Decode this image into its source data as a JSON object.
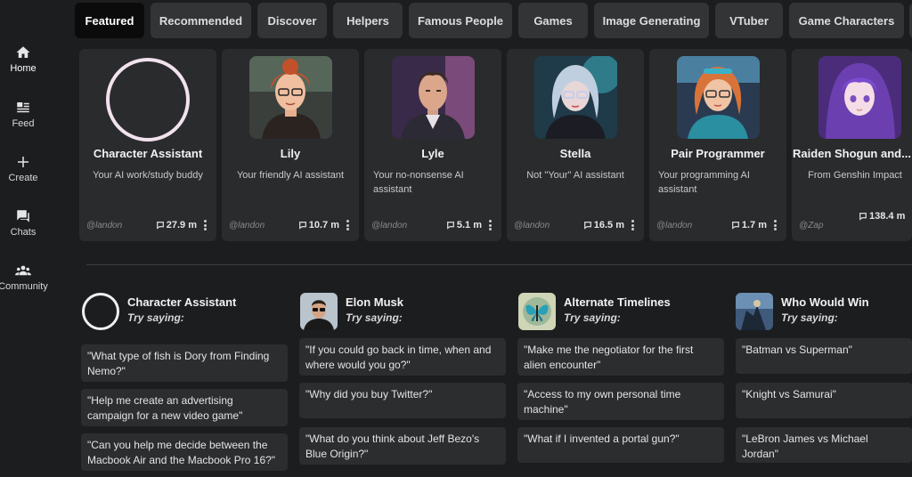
{
  "sidebar": {
    "items": [
      {
        "label": "Home",
        "icon": "home-icon"
      },
      {
        "label": "Feed",
        "icon": "feed-icon"
      },
      {
        "label": "Create",
        "icon": "plus-icon"
      },
      {
        "label": "Chats",
        "icon": "chat-icon"
      },
      {
        "label": "Community",
        "icon": "community-icon"
      }
    ]
  },
  "tabs": [
    "Featured",
    "Recommended",
    "Discover",
    "Helpers",
    "Famous People",
    "Games",
    "Image Generating",
    "VTuber",
    "Game Characters"
  ],
  "cards": [
    {
      "name": "Character Assistant",
      "desc": "Your AI work/study buddy",
      "author": "@landon",
      "stats": "27.9 m"
    },
    {
      "name": "Lily",
      "desc": "Your friendly AI assistant",
      "author": "@landon",
      "stats": "10.7 m"
    },
    {
      "name": "Lyle",
      "desc": "Your no-nonsense AI assistant",
      "author": "@landon",
      "stats": "5.1 m"
    },
    {
      "name": "Stella",
      "desc": "Not \"Your\" AI assistant",
      "author": "@landon",
      "stats": "16.5 m"
    },
    {
      "name": "Pair Programmer",
      "desc": "Your programming AI assistant",
      "author": "@landon",
      "stats": "1.7 m"
    },
    {
      "name": "Raiden Shogun and...",
      "desc": "From Genshin Impact",
      "author": "@Zap",
      "stats": "138.4 m"
    }
  ],
  "columns": [
    {
      "name": "Character Assistant",
      "try": "Try saying:",
      "prompts": [
        "\"What type of fish is Dory from Finding Nemo?\"",
        "\"Help me create an advertising campaign for a new video game\"",
        "\"Can you help me decide between the Macbook Air and the Macbook Pro 16?\""
      ]
    },
    {
      "name": "Elon Musk",
      "try": "Try saying:",
      "prompts": [
        "\"If you could go back in time, when and where would you go?\"",
        "\"Why did you buy Twitter?\"",
        "\"What do you think about Jeff Bezo's Blue Origin?\""
      ]
    },
    {
      "name": "Alternate Timelines",
      "try": "Try saying:",
      "prompts": [
        "\"Make me the negotiator for the first alien encounter\"",
        "\"Access to my own personal time machine\"",
        "\"What if I invented a portal gun?\""
      ]
    },
    {
      "name": "Who Would Win",
      "try": "Try saying:",
      "prompts": [
        "\"Batman vs Superman\"",
        "\"Knight vs Samurai\"",
        "\"LeBron James vs Michael Jordan\""
      ]
    }
  ]
}
